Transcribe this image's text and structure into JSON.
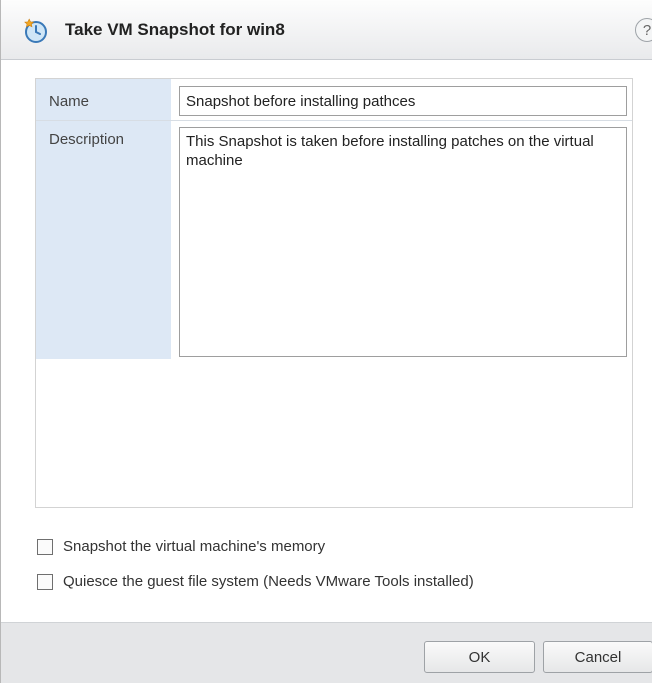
{
  "dialog": {
    "title": "Take VM Snapshot for win8",
    "help_glyph": "?",
    "title_icon": "snapshot-icon",
    "help_icon": "help-icon"
  },
  "form": {
    "name_label": "Name",
    "name_value": "Snapshot before installing pathces",
    "description_label": "Description",
    "description_value": "This Snapshot is taken before installing patches on the virtual machine"
  },
  "options": [
    {
      "label": "Snapshot the virtual machine's memory",
      "checked": false
    },
    {
      "label": "Quiesce the guest file system (Needs VMware Tools installed)",
      "checked": false
    }
  ],
  "buttons": {
    "ok_label": "OK",
    "cancel_label": "Cancel"
  },
  "colors": {
    "label_background": "#dde8f5",
    "footer_background": "#e5e6e8",
    "title_background": "#e9eaec"
  }
}
